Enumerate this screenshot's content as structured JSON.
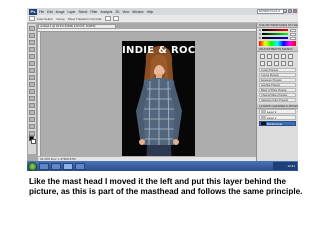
{
  "app": {
    "logo": "Ps",
    "menu": [
      "File",
      "Edit",
      "Image",
      "Layer",
      "Select",
      "Filter",
      "Analysis",
      "3D",
      "View",
      "Window",
      "Help"
    ],
    "workspace": "ESSENTIALS ▾",
    "window_controls": [
      "–",
      "□",
      "×"
    ]
  },
  "options_bar": {
    "items": [
      "Auto-Select:",
      "Group",
      "Show Transform Controls"
    ]
  },
  "document": {
    "tab_title": "untitled-1 @ 33.3% (INDIE & ROCK, RGB/8)",
    "masthead": "INDIE & ROCK",
    "status": "33.33%   Doc: 1.37M/9.87M"
  },
  "panels": {
    "color_tab": "COLOR  SWATCHES  STYLES",
    "color_sliders": [
      "R",
      "G",
      "B"
    ],
    "adjustments_tab": "ADJUSTMENTS  MASKS",
    "adjustment_items": [
      "Levels Presets",
      "Curves Presets",
      "Exposure Presets",
      "Hue/Sat Presets",
      "Black & White Presets",
      "Channel Mixer Presets",
      "Selective Color Presets"
    ],
    "layers_tab": "LAYERS  CHANNELS  PATHS",
    "layers": [
      {
        "name": "Layer 2",
        "selected": false
      },
      {
        "name": "Layer 1",
        "selected": false
      },
      {
        "name": "Background",
        "selected": true
      }
    ]
  },
  "taskbar": {
    "clock": "12:41"
  },
  "caption": "Like the mast head I moved it the left and put this layer behind the picture, as this is part of the masthead and follows the same principle."
}
